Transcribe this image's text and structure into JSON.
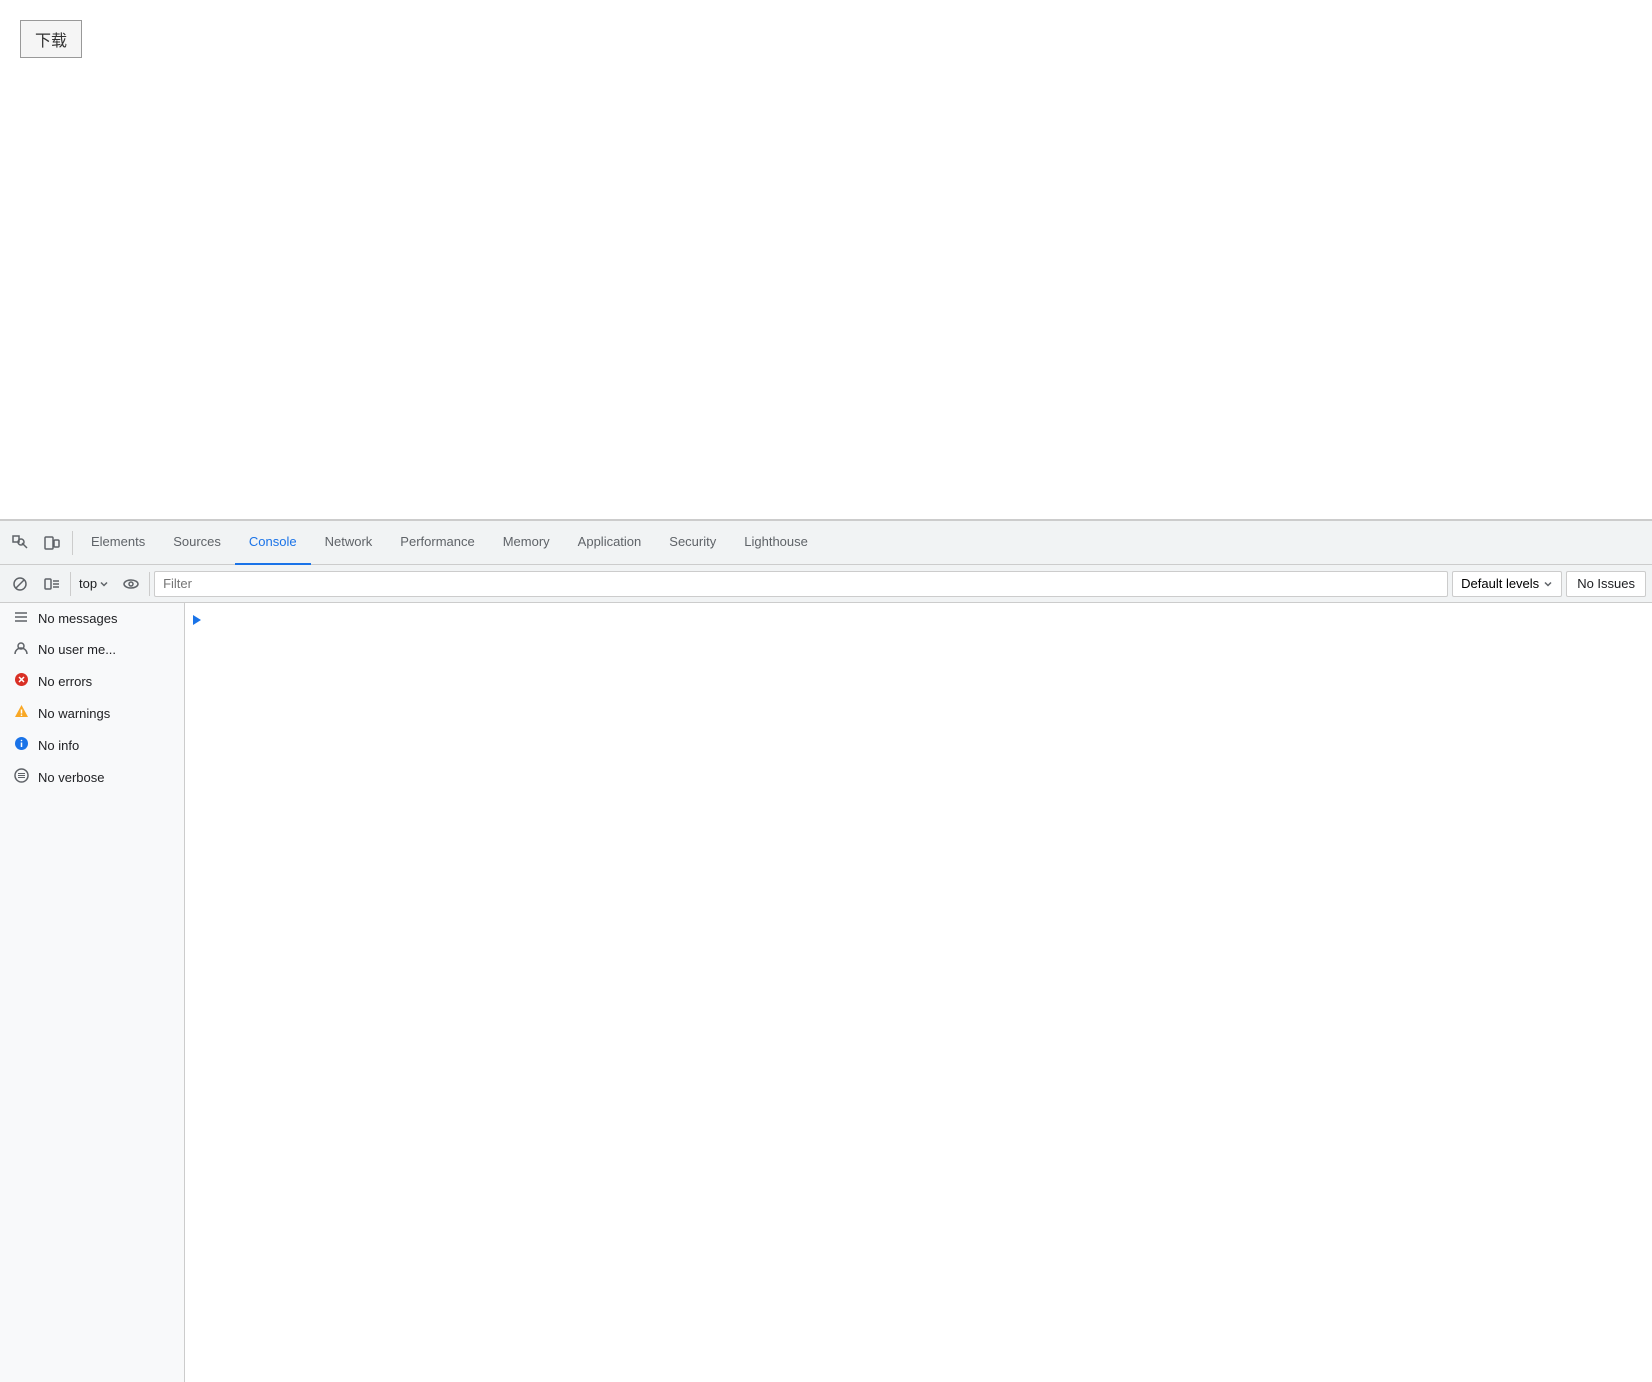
{
  "page": {
    "download_button_label": "下载"
  },
  "devtools": {
    "tabs": [
      {
        "id": "elements",
        "label": "Elements",
        "active": false
      },
      {
        "id": "sources",
        "label": "Sources",
        "active": false
      },
      {
        "id": "console",
        "label": "Console",
        "active": true
      },
      {
        "id": "network",
        "label": "Network",
        "active": false
      },
      {
        "id": "performance",
        "label": "Performance",
        "active": false
      },
      {
        "id": "memory",
        "label": "Memory",
        "active": false
      },
      {
        "id": "application",
        "label": "Application",
        "active": false
      },
      {
        "id": "security",
        "label": "Security",
        "active": false
      },
      {
        "id": "lighthouse",
        "label": "Lighthouse",
        "active": false
      }
    ],
    "toolbar": {
      "top_label": "top",
      "filter_placeholder": "Filter",
      "default_levels_label": "Default levels",
      "no_issues_label": "No Issues"
    },
    "sidebar": {
      "items": [
        {
          "id": "no-messages",
          "label": "No messages",
          "icon": "list"
        },
        {
          "id": "no-user-messages",
          "label": "No user me...",
          "icon": "user"
        },
        {
          "id": "no-errors",
          "label": "No errors",
          "icon": "error"
        },
        {
          "id": "no-warnings",
          "label": "No warnings",
          "icon": "warning"
        },
        {
          "id": "no-info",
          "label": "No info",
          "icon": "info"
        },
        {
          "id": "no-verbose",
          "label": "No verbose",
          "icon": "verbose"
        }
      ]
    }
  }
}
